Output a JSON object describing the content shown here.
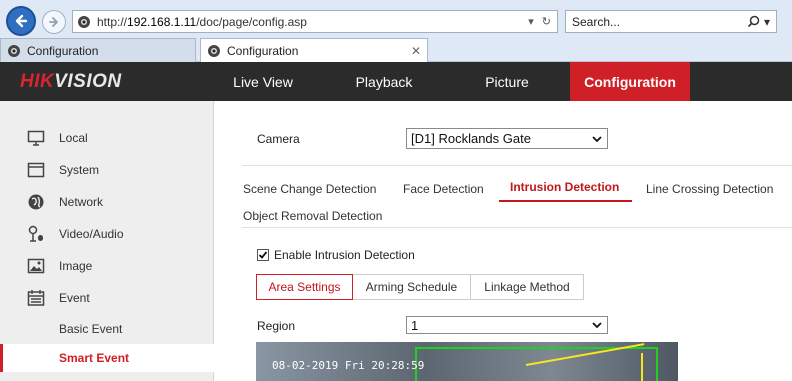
{
  "browser": {
    "url_prefix": "http://",
    "url_host": "192.168.1.11",
    "url_path": "/doc/page/config.asp",
    "search_placeholder": "Search...",
    "tabs": [
      {
        "label": "Configuration"
      },
      {
        "label": "Configuration"
      }
    ]
  },
  "app": {
    "logo_part1": "HIK",
    "logo_part2": "VISION",
    "nav": [
      {
        "label": "Live View"
      },
      {
        "label": "Playback"
      },
      {
        "label": "Picture"
      },
      {
        "label": "Configuration"
      }
    ]
  },
  "sidebar": {
    "items": [
      {
        "label": "Local",
        "icon": "monitor-icon"
      },
      {
        "label": "System",
        "icon": "system-window-icon"
      },
      {
        "label": "Network",
        "icon": "globe-icon"
      },
      {
        "label": "Video/Audio",
        "icon": "mic-icon"
      },
      {
        "label": "Image",
        "icon": "image-icon"
      },
      {
        "label": "Event",
        "icon": "calendar-icon"
      }
    ],
    "subitems": [
      {
        "label": "Basic Event"
      },
      {
        "label": "Smart Event"
      }
    ]
  },
  "main": {
    "camera_label": "Camera",
    "camera_value": "[D1] Rocklands Gate",
    "detection_tabs": [
      {
        "label": "Scene Change Detection"
      },
      {
        "label": "Face Detection"
      },
      {
        "label": "Intrusion Detection"
      },
      {
        "label": "Line Crossing Detection"
      },
      {
        "label": "Object Removal Detection"
      }
    ],
    "enable_label": "Enable Intrusion Detection",
    "sub_tabs": [
      {
        "label": "Area Settings"
      },
      {
        "label": "Arming Schedule"
      },
      {
        "label": "Linkage Method"
      }
    ],
    "region_label": "Region",
    "region_value": "1",
    "video_timestamp": "08-02-2019 Fri 20:28:59"
  },
  "colors": {
    "accent_red": "#d02027",
    "header_dark": "#2b2b2b",
    "sidebar_bg": "#eeeeee",
    "zone_green": "#1fd11f",
    "line_yellow": "#f6e61c"
  }
}
